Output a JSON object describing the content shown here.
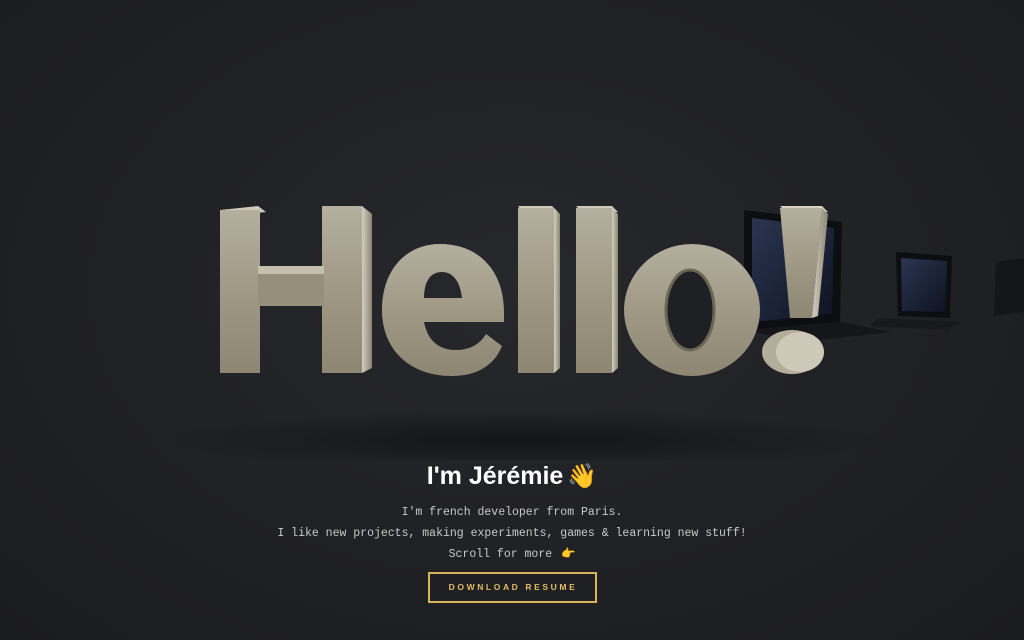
{
  "hero": {
    "greeting": "Hello!"
  },
  "intro": {
    "name": "I'm Jérémie",
    "wave_icon": "👋",
    "line1": "I'm french developer from Paris.",
    "line2": "I like new projects, making experiments, games & learning new stuff!",
    "line3": "Scroll for more",
    "point_icon": "👉",
    "cta_label": "DOWNLOAD RESUME"
  },
  "colors": {
    "background": "#1f2024",
    "letters": "#a8a190",
    "accent": "#e0bd63"
  }
}
